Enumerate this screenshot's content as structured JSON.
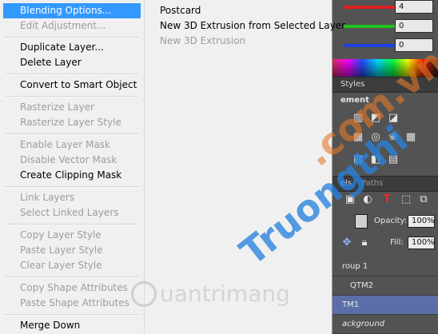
{
  "menu": {
    "items": [
      {
        "label": "Blending Options...",
        "enabled": true,
        "highlighted": true
      },
      {
        "label": "Edit Adjustment...",
        "enabled": false
      },
      {
        "label": "Duplicate Layer...",
        "enabled": true
      },
      {
        "label": "Delete Layer",
        "enabled": true
      },
      {
        "label": "Convert to Smart Object",
        "enabled": true
      },
      {
        "label": "Rasterize Layer",
        "enabled": false
      },
      {
        "label": "Rasterize Layer Style",
        "enabled": false
      },
      {
        "label": "Enable Layer Mask",
        "enabled": false
      },
      {
        "label": "Disable Vector Mask",
        "enabled": false
      },
      {
        "label": "Create Clipping Mask",
        "enabled": true
      },
      {
        "label": "Link Layers",
        "enabled": false
      },
      {
        "label": "Select Linked Layers",
        "enabled": false
      },
      {
        "label": "Copy Layer Style",
        "enabled": false
      },
      {
        "label": "Paste Layer Style",
        "enabled": false
      },
      {
        "label": "Clear Layer Style",
        "enabled": false
      },
      {
        "label": "Copy Shape Attributes",
        "enabled": false
      },
      {
        "label": "Paste Shape Attributes",
        "enabled": false
      },
      {
        "label": "Merge Down",
        "enabled": true
      }
    ],
    "submenu": [
      {
        "label": "Postcard",
        "enabled": true
      },
      {
        "label": "New 3D Extrusion from Selected Layer",
        "enabled": true
      },
      {
        "label": "New 3D Extrusion",
        "enabled": false
      }
    ]
  },
  "color_panel": {
    "values": [
      "4",
      "0",
      "0"
    ],
    "slider_colors": [
      "#e02020",
      "#20c020",
      "#2040e0"
    ]
  },
  "panels": {
    "styles_tab": "Styles",
    "adjustments_label": "ement",
    "layers_tabs": [
      "els",
      "Paths"
    ],
    "opacity_label": "Opacity:",
    "opacity_value": "100%",
    "fill_label": "Fill:",
    "fill_value": "100%",
    "layers": [
      {
        "name": "roup 1",
        "selected": false
      },
      {
        "name": "QTM2",
        "selected": false
      },
      {
        "name": "TM1",
        "selected": true
      },
      {
        "name": "ackground",
        "selected": false
      }
    ]
  },
  "watermark": {
    "brand": "uantrimang",
    "diagonal_main": "Truongthi",
    "diagonal_accent": ".com.vn"
  }
}
